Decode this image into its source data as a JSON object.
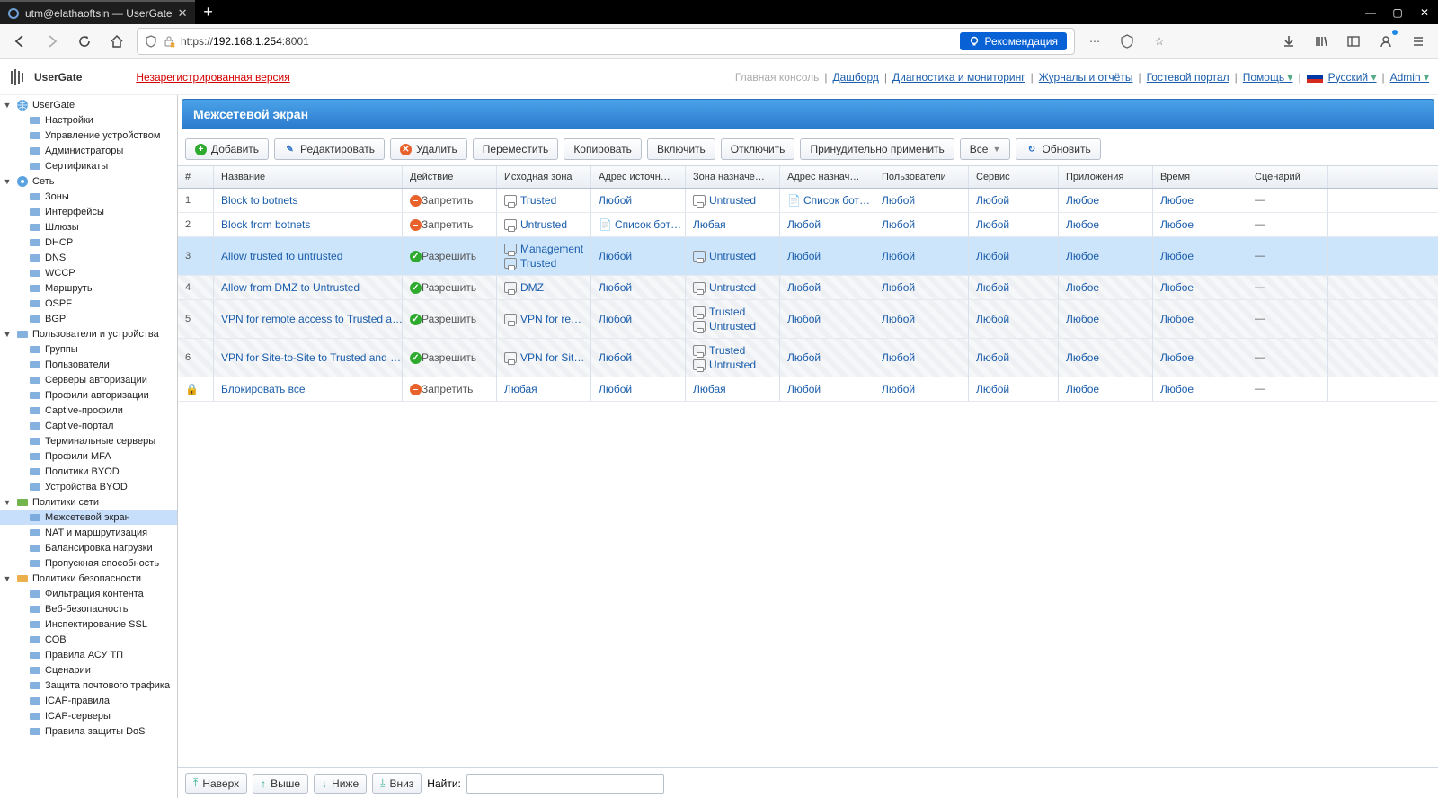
{
  "browser": {
    "tab_title": "utm@elathaoftsin — UserGate",
    "url_prefix": "https://",
    "url_host": "192.168.1.254",
    "url_port": ":8001",
    "recommendation": "Рекомендация"
  },
  "app": {
    "logo": "UserGate",
    "unregistered": "Незарегистрированная версия"
  },
  "toplinks": {
    "main": "Главная консоль",
    "dashboard": "Дашборд",
    "diag": "Диагностика и мониторинг",
    "logs": "Журналы и отчёты",
    "guest": "Гостевой портал",
    "help": "Помощь",
    "lang": "Русский",
    "admin": "Admin"
  },
  "tree": [
    {
      "lvl": 0,
      "tw": "▼",
      "icon": "globe",
      "label": "UserGate",
      "color": "#2a70c8"
    },
    {
      "lvl": 1,
      "icon": "gear",
      "label": "Настройки"
    },
    {
      "lvl": 1,
      "icon": "device",
      "label": "Управление устройством"
    },
    {
      "lvl": 1,
      "icon": "users",
      "label": "Администраторы"
    },
    {
      "lvl": 1,
      "icon": "cert",
      "label": "Сертификаты"
    },
    {
      "lvl": 0,
      "tw": "▼",
      "icon": "net",
      "label": "Сеть",
      "color": "#2a70c8"
    },
    {
      "lvl": 1,
      "icon": "zone",
      "label": "Зоны"
    },
    {
      "lvl": 1,
      "icon": "iface",
      "label": "Интерфейсы"
    },
    {
      "lvl": 1,
      "icon": "gw",
      "label": "Шлюзы"
    },
    {
      "lvl": 1,
      "icon": "dhcp",
      "label": "DHCP"
    },
    {
      "lvl": 1,
      "icon": "dns",
      "label": "DNS"
    },
    {
      "lvl": 1,
      "icon": "wccp",
      "label": "WCCP"
    },
    {
      "lvl": 1,
      "icon": "route",
      "label": "Маршруты"
    },
    {
      "lvl": 1,
      "icon": "ospf",
      "label": "OSPF"
    },
    {
      "lvl": 1,
      "icon": "bgp",
      "label": "BGP"
    },
    {
      "lvl": 0,
      "tw": "▼",
      "icon": "users2",
      "label": "Пользователи и устройства"
    },
    {
      "lvl": 1,
      "icon": "grp",
      "label": "Группы"
    },
    {
      "lvl": 1,
      "icon": "usr",
      "label": "Пользователи"
    },
    {
      "lvl": 1,
      "icon": "srv",
      "label": "Серверы авторизации"
    },
    {
      "lvl": 1,
      "icon": "prof",
      "label": "Профили авторизации"
    },
    {
      "lvl": 1,
      "icon": "cap",
      "label": "Captive-профили"
    },
    {
      "lvl": 1,
      "icon": "cap2",
      "label": "Captive-портал"
    },
    {
      "lvl": 1,
      "icon": "term",
      "label": "Терминальные серверы"
    },
    {
      "lvl": 1,
      "icon": "mfa",
      "label": "Профили MFA"
    },
    {
      "lvl": 1,
      "icon": "byod",
      "label": "Политики BYOD"
    },
    {
      "lvl": 1,
      "icon": "byod2",
      "label": "Устройства BYOD"
    },
    {
      "lvl": 0,
      "tw": "▼",
      "icon": "netpol",
      "label": "Политики сети",
      "color": "#5aa82e"
    },
    {
      "lvl": 1,
      "icon": "fw",
      "label": "Межсетевой экран",
      "sel": true
    },
    {
      "lvl": 1,
      "icon": "nat",
      "label": "NAT и маршрутизация"
    },
    {
      "lvl": 1,
      "icon": "bal",
      "label": "Балансировка нагрузки"
    },
    {
      "lvl": 1,
      "icon": "bw",
      "label": "Пропускная способность"
    },
    {
      "lvl": 0,
      "tw": "▼",
      "icon": "secpol",
      "label": "Политики безопасности",
      "color": "#e8a22b"
    },
    {
      "lvl": 1,
      "icon": "cf",
      "label": "Фильтрация контента"
    },
    {
      "lvl": 1,
      "icon": "web",
      "label": "Веб-безопасность"
    },
    {
      "lvl": 1,
      "icon": "ssl",
      "label": "Инспектирование SSL"
    },
    {
      "lvl": 1,
      "icon": "sov",
      "label": "СОВ"
    },
    {
      "lvl": 1,
      "icon": "asu",
      "label": "Правила АСУ ТП"
    },
    {
      "lvl": 1,
      "icon": "scen",
      "label": "Сценарии"
    },
    {
      "lvl": 1,
      "icon": "mail",
      "label": "Защита почтового трафика"
    },
    {
      "lvl": 1,
      "icon": "icap",
      "label": "ICAP-правила"
    },
    {
      "lvl": 1,
      "icon": "icap2",
      "label": "ICAP-серверы"
    },
    {
      "lvl": 1,
      "icon": "dos",
      "label": "Правила защиты DoS"
    }
  ],
  "panel_title": "Межсетевой экран",
  "toolbar": {
    "add": "Добавить",
    "edit": "Редактировать",
    "del": "Удалить",
    "move": "Переместить",
    "copy": "Копировать",
    "enable": "Включить",
    "disable": "Отключить",
    "apply": "Принудительно применить",
    "all": "Все",
    "refresh": "Обновить"
  },
  "columns": [
    "#",
    "Название",
    "Действие",
    "Исходная зона",
    "Адрес источн…",
    "Зона назначе…",
    "Адрес назнач…",
    "Пользователи",
    "Сервис",
    "Приложения",
    "Время",
    "Сценарий"
  ],
  "rows": [
    {
      "n": "1",
      "name": "Block to botnets",
      "act": "deny",
      "act_t": "Запретить",
      "src": [
        {
          "t": "Trusted"
        }
      ],
      "srcaddr": "Любой",
      "dst": [
        {
          "t": "Untrusted"
        }
      ],
      "dstaddr": "Список бот…",
      "dstaddr_icon": true,
      "users": "Любой",
      "svc": "Любой",
      "apps": "Любое",
      "time": "Любое",
      "scn": "—",
      "cls": ""
    },
    {
      "n": "2",
      "name": "Block from botnets",
      "act": "deny",
      "act_t": "Запретить",
      "src": [
        {
          "t": "Untrusted"
        }
      ],
      "srcaddr": "Список бот…",
      "srcaddr_icon": true,
      "dst": [],
      "dst_t": "Любая",
      "dstaddr": "Любой",
      "users": "Любой",
      "svc": "Любой",
      "apps": "Любое",
      "time": "Любое",
      "scn": "—",
      "cls": ""
    },
    {
      "n": "3",
      "name": "Allow trusted to untrusted",
      "act": "allow",
      "act_t": "Разрешить",
      "src": [
        {
          "t": "Management"
        },
        {
          "t": "Trusted"
        }
      ],
      "srcaddr": "Любой",
      "dst": [
        {
          "t": "Untrusted"
        }
      ],
      "dstaddr": "Любой",
      "users": "Любой",
      "svc": "Любой",
      "apps": "Любое",
      "time": "Любое",
      "scn": "—",
      "cls": "sel"
    },
    {
      "n": "4",
      "name": "Allow from DMZ to Untrusted",
      "act": "allow",
      "act_t": "Разрешить",
      "src": [
        {
          "t": "DMZ"
        }
      ],
      "srcaddr": "Любой",
      "dst": [
        {
          "t": "Untrusted"
        }
      ],
      "dstaddr": "Любой",
      "users": "Любой",
      "svc": "Любой",
      "apps": "Любое",
      "time": "Любое",
      "scn": "—",
      "cls": "dis"
    },
    {
      "n": "5",
      "name": "VPN for remote access to Trusted a…",
      "act": "allow",
      "act_t": "Разрешить",
      "src": [
        {
          "t": "VPN for re…"
        }
      ],
      "srcaddr": "Любой",
      "dst": [
        {
          "t": "Trusted"
        },
        {
          "t": "Untrusted"
        }
      ],
      "dstaddr": "Любой",
      "users": "Любой",
      "svc": "Любой",
      "apps": "Любое",
      "time": "Любое",
      "scn": "—",
      "cls": "dis"
    },
    {
      "n": "6",
      "name": "VPN for Site-to-Site to Trusted and …",
      "act": "allow",
      "act_t": "Разрешить",
      "src": [
        {
          "t": "VPN for Sit…"
        }
      ],
      "srcaddr": "Любой",
      "dst": [
        {
          "t": "Trusted"
        },
        {
          "t": "Untrusted"
        }
      ],
      "dstaddr": "Любой",
      "users": "Любой",
      "svc": "Любой",
      "apps": "Любое",
      "time": "Любое",
      "scn": "—",
      "cls": "dis"
    },
    {
      "n": "lock",
      "name": "Блокировать все",
      "act": "deny",
      "act_t": "Запретить",
      "src_t": "Любая",
      "srcaddr": "Любой",
      "dst_t": "Любая",
      "dstaddr": "Любой",
      "users": "Любой",
      "svc": "Любой",
      "apps": "Любое",
      "time": "Любое",
      "scn": "—",
      "cls": ""
    }
  ],
  "bottom": {
    "top": "Наверх",
    "up": "Выше",
    "down": "Ниже",
    "bottom": "Вниз",
    "search": "Найти:"
  }
}
